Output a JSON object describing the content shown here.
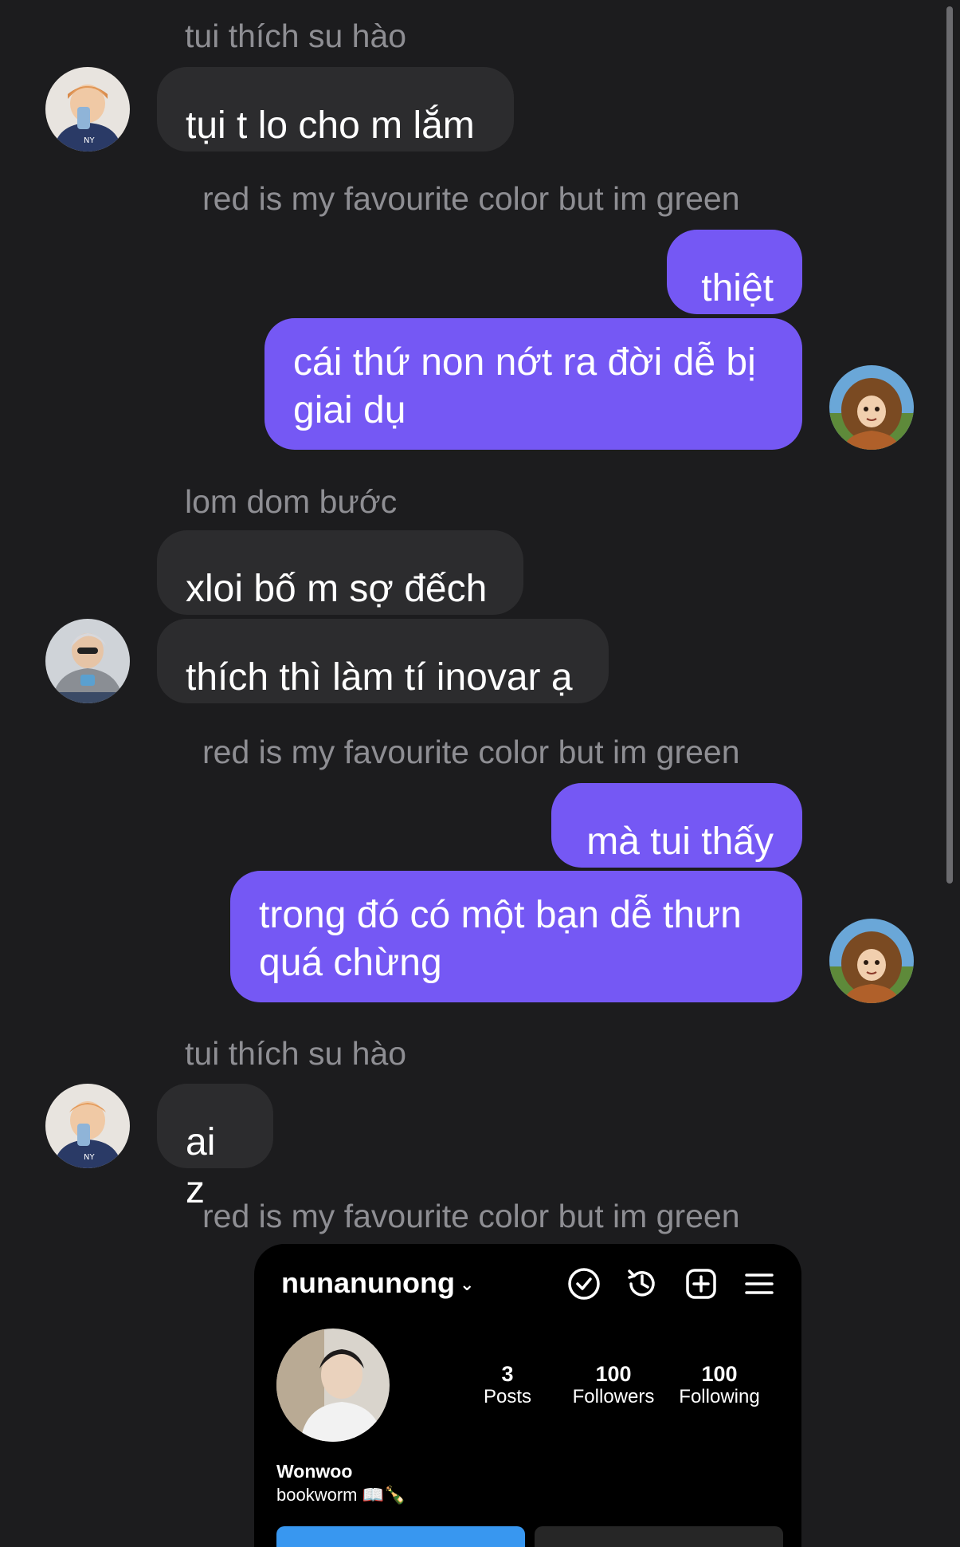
{
  "messages": [
    {
      "sender": "tui thích su hào",
      "text": "tụi t lo cho m lắm"
    },
    {
      "sender": "red is my favourite color but im green",
      "text": "thiệt"
    },
    {
      "sender": "red is my favourite color but im green",
      "text": "cái thứ non nớt ra đời dễ bị giai dụ"
    },
    {
      "sender": "lom dom bước",
      "text": "xloi bố m sợ đếch"
    },
    {
      "sender": "lom dom bước",
      "text": "thích thì làm tí inovar ạ"
    },
    {
      "sender": "red is my favourite color but im green",
      "text": "mà tui thấy"
    },
    {
      "sender": "red is my favourite color but im green",
      "text": "trong đó có một bạn dễ thưn quá chừng"
    },
    {
      "sender": "tui thích su hào",
      "text": "ai z"
    },
    {
      "sender": "red is my favourite color but im green",
      "text": ""
    }
  ],
  "shared_profile": {
    "username": "nunanunong",
    "posts_count": "3",
    "posts_label": "Posts",
    "followers_count": "100",
    "followers_label": "Followers",
    "following_count": "100",
    "following_label": "Following",
    "display_name": "Wonwoo",
    "bio": "bookworm 📖🍾",
    "icons": [
      "check-circle-icon",
      "history-icon",
      "add-square-icon",
      "menu-icon"
    ]
  },
  "colors": {
    "background": "#1c1c1e",
    "incoming_bubble": "#2c2c2e",
    "outgoing_bubble": "#7558f4",
    "sender_name": "#8e8e93"
  }
}
